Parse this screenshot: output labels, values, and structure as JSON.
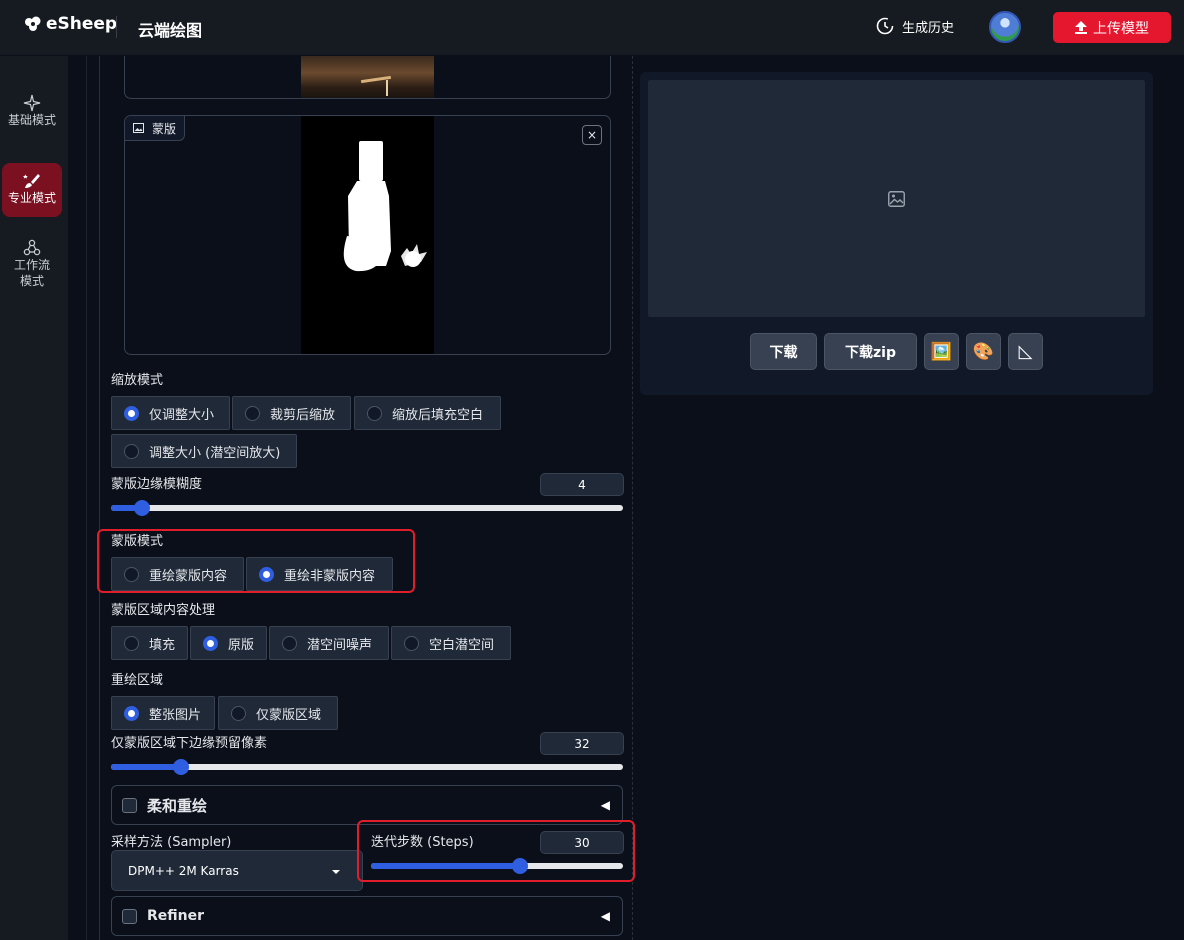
{
  "header": {
    "logo_text": "eSheep",
    "app_title": "云端绘图",
    "history_label": "生成历史",
    "upload_label": "上传模型"
  },
  "nav": {
    "items": [
      {
        "label": "基础模式",
        "icon": "sparkle-icon",
        "active": false
      },
      {
        "label": "专业模式",
        "icon": "brush-icon",
        "active": true
      },
      {
        "label": "工作流\n模式",
        "icon": "workflow-icon",
        "active": false
      }
    ]
  },
  "mask_panel": {
    "label": "蒙版",
    "close_symbol": "×"
  },
  "resize_mode": {
    "label": "缩放模式",
    "options": [
      "仅调整大小",
      "裁剪后缩放",
      "缩放后填充空白",
      "调整大小 (潜空间放大)"
    ],
    "selected": 0
  },
  "mask_blur": {
    "label": "蒙版边缘模糊度",
    "value": "4",
    "fraction": 0.06
  },
  "mask_mode": {
    "label": "蒙版模式",
    "options": [
      "重绘蒙版内容",
      "重绘非蒙版内容"
    ],
    "selected": 1
  },
  "masked_content": {
    "label": "蒙版区域内容处理",
    "options": [
      "填充",
      "原版",
      "潜空间噪声",
      "空白潜空间"
    ],
    "selected": 1
  },
  "inpaint_area": {
    "label": "重绘区域",
    "options": [
      "整张图片",
      "仅蒙版区域"
    ],
    "selected": 0
  },
  "padding": {
    "label": "仅蒙版区域下边缘预留像素",
    "value": "32",
    "fraction": 0.136
  },
  "soft_inpaint": {
    "label": "柔和重绘",
    "arrow": "◀"
  },
  "sampler": {
    "label": "采样方法 (Sampler)",
    "value": "DPM++ 2M Karras"
  },
  "steps": {
    "label": "迭代步数 (Steps)",
    "value": "30",
    "fraction": 0.59
  },
  "refiner": {
    "label": "Refiner",
    "arrow": "◀"
  },
  "output": {
    "download_label": "下载",
    "download_zip_label": "下载zip",
    "send_to_img2img_icon": "🖼️",
    "send_to_inpaint_icon": "🎨",
    "extras_icon": "◺"
  },
  "colors": {
    "accent": "#2f5fe0",
    "brand_red": "#e5172f",
    "highlight_red": "#e01e2b"
  }
}
